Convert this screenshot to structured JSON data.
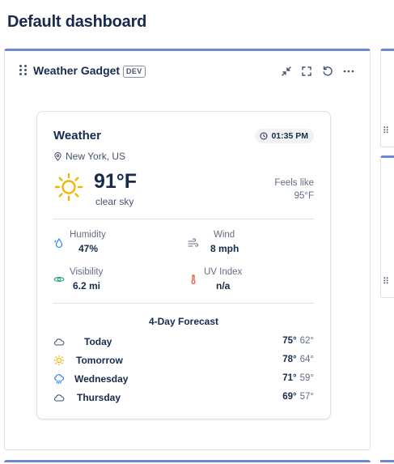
{
  "page": {
    "title": "Default dashboard"
  },
  "gadget": {
    "title": "Weather Gadget",
    "badge": "DEV",
    "header_icons": [
      "minimize-icon",
      "fullscreen-icon",
      "refresh-icon",
      "more-icon"
    ]
  },
  "weather": {
    "title": "Weather",
    "time": "01:35 PM",
    "location": "New York, US",
    "temperature": "91°F",
    "condition": "clear sky",
    "feels_like_label": "Feels like",
    "feels_like_value": "95°F",
    "stats": [
      {
        "label": "Humidity",
        "value": "47%",
        "icon": "humidity-icon",
        "color": "#1d7afc"
      },
      {
        "label": "Wind",
        "value": "8 mph",
        "icon": "wind-icon",
        "color": "#626f86"
      },
      {
        "label": "Visibility",
        "value": "6.2 mi",
        "icon": "eye-icon",
        "color": "#22a06b"
      },
      {
        "label": "UV Index",
        "value": "n/a",
        "icon": "thermometer-icon",
        "color": "#e34935"
      }
    ],
    "forecast_title": "4-Day Forecast",
    "forecast": [
      {
        "day": "Today",
        "icon": "cloud-icon",
        "high": "75°",
        "low": "62°"
      },
      {
        "day": "Tomorrow",
        "icon": "sun-icon",
        "high": "78°",
        "low": "64°"
      },
      {
        "day": "Wednesday",
        "icon": "rain-icon",
        "high": "71°",
        "low": "59°"
      },
      {
        "day": "Thursday",
        "icon": "cloud-icon",
        "high": "69°",
        "low": "57°"
      }
    ]
  },
  "colors": {
    "accent": "#6f86d6",
    "sun": "#f5b400",
    "rain": "#1d7afc"
  }
}
